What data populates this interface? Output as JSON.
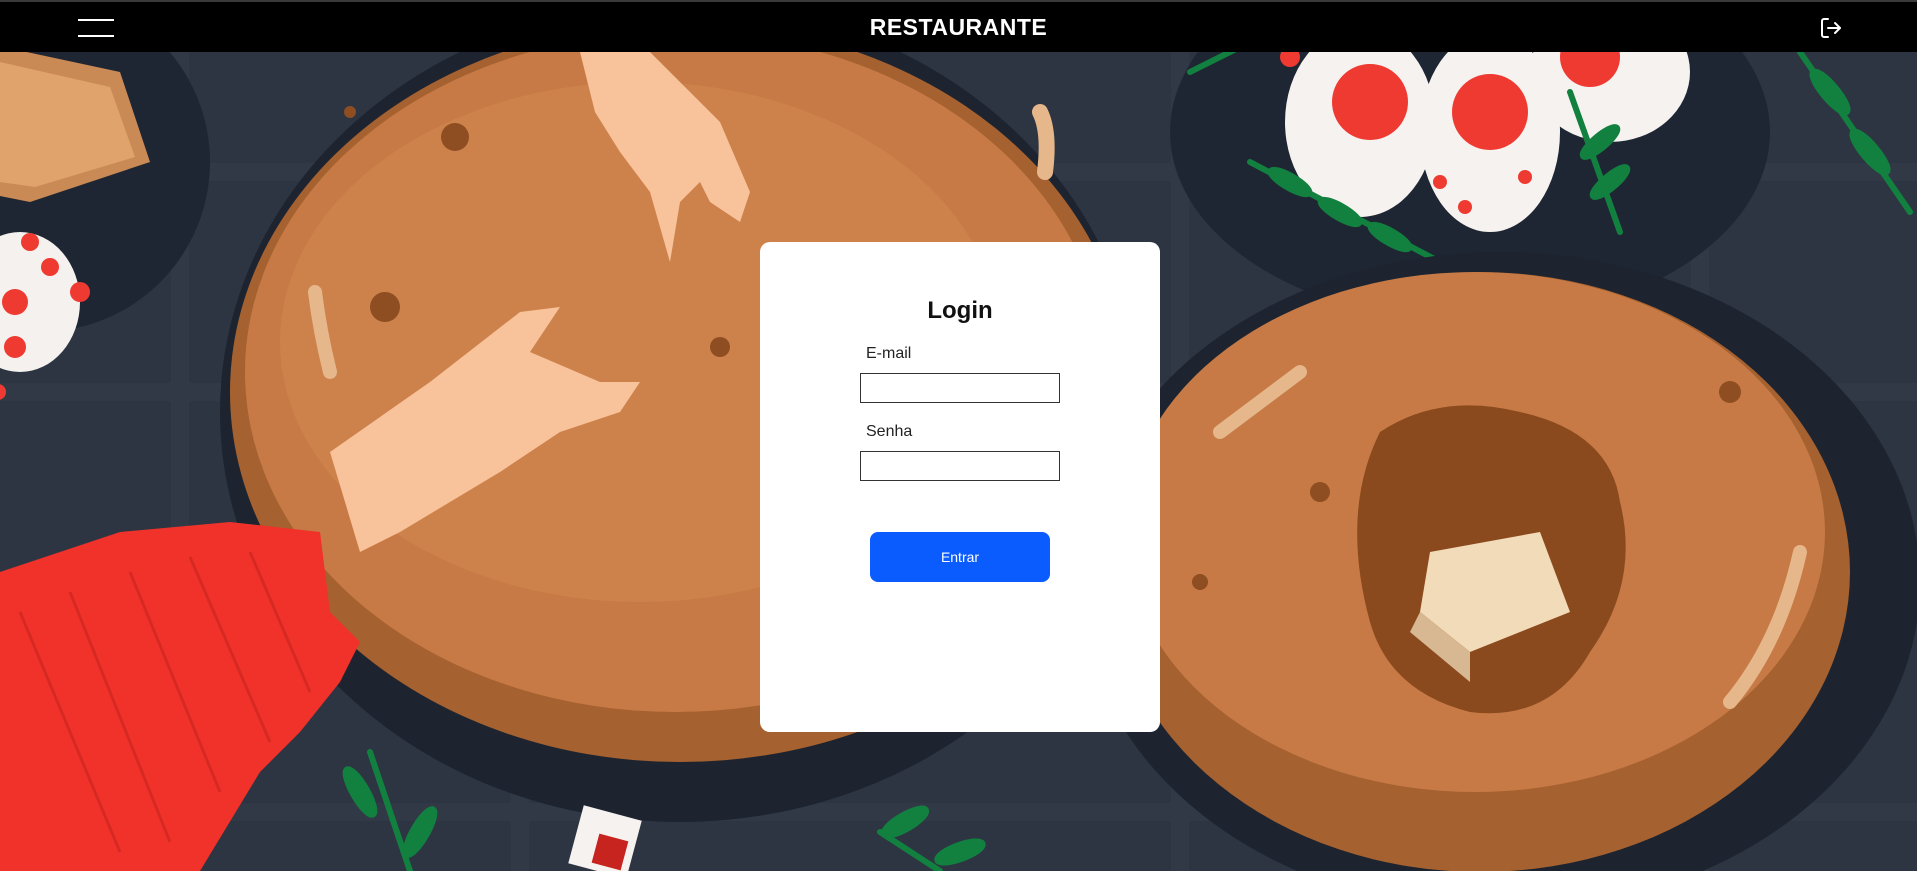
{
  "header": {
    "title": "RESTAURANTE",
    "menu_icon": "hamburger-menu-icon",
    "logout_icon": "logout-icon"
  },
  "login": {
    "title": "Login",
    "email_label": "E-mail",
    "email_value": "",
    "password_label": "Senha",
    "password_value": "",
    "submit_label": "Entrar"
  },
  "colors": {
    "header_bg": "#000000",
    "card_bg": "#ffffff",
    "button_bg": "#0a5cff",
    "background_base": "#2c3340",
    "pancake": "#c77a45",
    "sleeve": "#f0322a"
  }
}
